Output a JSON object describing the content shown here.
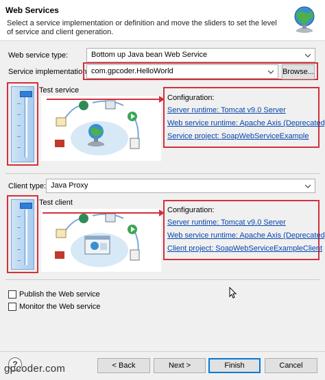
{
  "header": {
    "title": "Web Services",
    "description": "Select a service implementation or definition and move the sliders to set the level of service and client generation."
  },
  "service": {
    "type_label": "Web service type:",
    "type_value": "Bottom up Java bean Web Service",
    "impl_label": "Service implementation:",
    "impl_value": "com.gpcoder.HelloWorld",
    "browse_label": "Browse...",
    "slider_label": "Test service",
    "slider_level": "Test service",
    "config_title": "Configuration:",
    "config_links": [
      "Server runtime: Tomcat v9.0 Server",
      "Web service runtime: Apache Axis (Deprecated)",
      "Service project: SoapWebServiceExample"
    ]
  },
  "client": {
    "type_label": "Client type:",
    "type_value": "Java Proxy",
    "slider_label": "Test client",
    "slider_level": "Test client",
    "config_title": "Configuration:",
    "config_links": [
      "Server runtime: Tomcat v9.0 Server",
      "Web service runtime: Apache Axis (Deprecated)",
      "Client project: SoapWebServiceExampleClient"
    ]
  },
  "options": {
    "publish_label": "Publish the Web service",
    "publish_checked": false,
    "monitor_label": "Monitor the Web service",
    "monitor_checked": false
  },
  "footer": {
    "help_icon": "?",
    "back_label": "< Back",
    "next_label": "Next >",
    "finish_label": "Finish",
    "cancel_label": "Cancel"
  },
  "watermark": "gpcoder.com",
  "colors": {
    "highlight_red": "#d32f3a",
    "link_blue": "#0645ad",
    "slider_blue": "#2f7ed8"
  }
}
